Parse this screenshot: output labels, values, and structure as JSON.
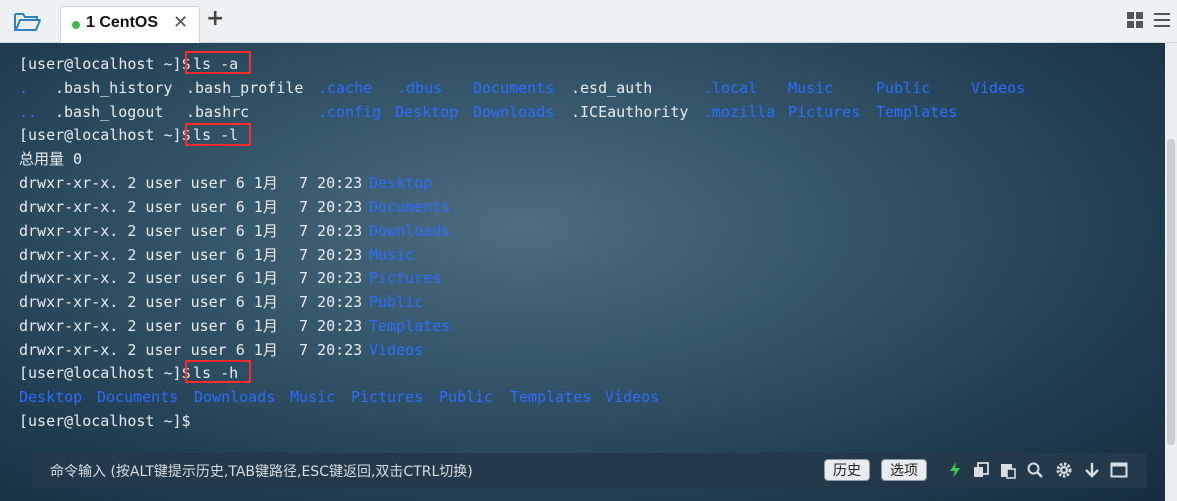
{
  "tabbar": {
    "tab_label": "1 CentOS",
    "close_glyph": "✕",
    "add_glyph": "+",
    "icons": [
      "folder-open-icon",
      "layout-grid-icon",
      "hamburger-menu-icon"
    ]
  },
  "terminal": {
    "lines": [
      {
        "prompt": "[user@localhost ~]$",
        "command": "ls -a"
      },
      {
        "entries": [
          {
            "text": ".",
            "dir": true
          },
          {
            "text": ".bash_history",
            "dir": false
          },
          {
            "text": ".bash_profile",
            "dir": false
          },
          {
            "text": ".cache",
            "dir": true
          },
          {
            "text": ".dbus",
            "dir": true
          },
          {
            "text": "Documents",
            "dir": true
          },
          {
            "text": ".esd_auth",
            "dir": false
          },
          {
            "text": ".local",
            "dir": true
          },
          {
            "text": "Music",
            "dir": true
          },
          {
            "text": "Public",
            "dir": true
          },
          {
            "text": "Videos",
            "dir": true
          }
        ]
      },
      {
        "entries": [
          {
            "text": "..",
            "dir": true
          },
          {
            "text": ".bash_logout",
            "dir": false
          },
          {
            "text": ".bashrc",
            "dir": false
          },
          {
            "text": ".config",
            "dir": true
          },
          {
            "text": "Desktop",
            "dir": true
          },
          {
            "text": "Downloads",
            "dir": true
          },
          {
            "text": ".ICEauthority",
            "dir": false
          },
          {
            "text": ".mozilla",
            "dir": true
          },
          {
            "text": "Pictures",
            "dir": true
          },
          {
            "text": "Templates",
            "dir": true
          }
        ]
      },
      {
        "prompt": "[user@localhost ~]$",
        "command": "ls -l"
      },
      {
        "text": "总用量 0"
      },
      {
        "perm": "drwxr-xr-x. 2 user user 6 1月",
        "time": "7 20:23",
        "name": "Desktop"
      },
      {
        "perm": "drwxr-xr-x. 2 user user 6 1月",
        "time": "7 20:23",
        "name": "Documents"
      },
      {
        "perm": "drwxr-xr-x. 2 user user 6 1月",
        "time": "7 20:23",
        "name": "Downloads"
      },
      {
        "perm": "drwxr-xr-x. 2 user user 6 1月",
        "time": "7 20:23",
        "name": "Music"
      },
      {
        "perm": "drwxr-xr-x. 2 user user 6 1月",
        "time": "7 20:23",
        "name": "Pictures"
      },
      {
        "perm": "drwxr-xr-x. 2 user user 6 1月",
        "time": "7 20:23",
        "name": "Public"
      },
      {
        "perm": "drwxr-xr-x. 2 user user 6 1月",
        "time": "7 20:23",
        "name": "Templates"
      },
      {
        "perm": "drwxr-xr-x. 2 user user 6 1月",
        "time": "7 20:23",
        "name": "Videos"
      },
      {
        "prompt": "[user@localhost ~]$",
        "command": "ls -h"
      },
      {
        "entries": [
          {
            "text": "Desktop",
            "dir": true
          },
          {
            "text": "Documents",
            "dir": true
          },
          {
            "text": "Downloads",
            "dir": true
          },
          {
            "text": "Music",
            "dir": true
          },
          {
            "text": "Pictures",
            "dir": true
          },
          {
            "text": "Public",
            "dir": true
          },
          {
            "text": "Templates",
            "dir": true
          },
          {
            "text": "Videos",
            "dir": true
          }
        ]
      },
      {
        "prompt": "[user@localhost ~]$",
        "command": ""
      }
    ],
    "colors": {
      "dir": "#2f6bff",
      "text": "#e8ecef",
      "highlight": "#ff2b2b"
    }
  },
  "inputbar": {
    "hint": "命令输入 (按ALT键提示历史,TAB键路径,ESC键返回,双击CTRL切换)",
    "history_label": "历史",
    "options_label": "选项",
    "icons": [
      "lightning-icon",
      "copy-icon",
      "paste-icon",
      "search-icon",
      "gear-icon",
      "download-arrow-icon",
      "window-icon"
    ]
  }
}
